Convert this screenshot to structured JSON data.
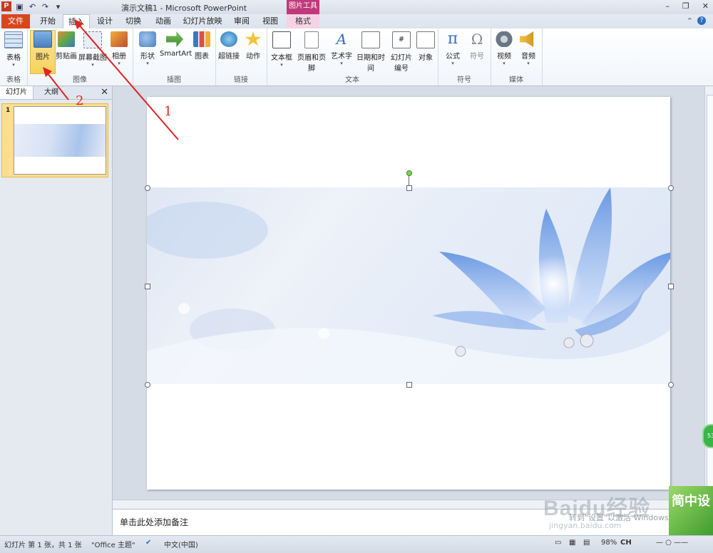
{
  "window": {
    "title": "演示文稿1 - Microsoft PowerPoint",
    "context_tool": "图片工具",
    "app_icon": "P",
    "controls": [
      "–",
      "❐",
      "✕"
    ]
  },
  "tabs": [
    {
      "label": "文件"
    },
    {
      "label": "开始"
    },
    {
      "label": "插入"
    },
    {
      "label": "设计"
    },
    {
      "label": "切换"
    },
    {
      "label": "动画"
    },
    {
      "label": "幻灯片放映"
    },
    {
      "label": "审阅"
    },
    {
      "label": "视图"
    },
    {
      "label": "格式"
    }
  ],
  "ribbon": {
    "groups": [
      {
        "label": "表格",
        "buttons": [
          {
            "label": "表格"
          }
        ]
      },
      {
        "label": "图像",
        "buttons": [
          {
            "label": "图片"
          },
          {
            "label": "剪贴画"
          },
          {
            "label": "屏幕截图"
          },
          {
            "label": "相册"
          }
        ]
      },
      {
        "label": "插图",
        "buttons": [
          {
            "label": "形状"
          },
          {
            "label": "SmartArt"
          },
          {
            "label": "图表"
          }
        ]
      },
      {
        "label": "链接",
        "buttons": [
          {
            "label": "超链接"
          },
          {
            "label": "动作"
          }
        ]
      },
      {
        "label": "文本",
        "buttons": [
          {
            "label": "文本框"
          },
          {
            "label": "页眉和页脚"
          },
          {
            "label": "艺术字"
          },
          {
            "label": "日期和时间"
          },
          {
            "label": "幻灯片编号"
          },
          {
            "label": "对象"
          }
        ]
      },
      {
        "label": "符号",
        "buttons": [
          {
            "label": "公式"
          },
          {
            "label": "符号"
          }
        ]
      },
      {
        "label": "媒体",
        "buttons": [
          {
            "label": "视频"
          },
          {
            "label": "音频"
          }
        ]
      }
    ]
  },
  "left_pane": {
    "tabs": [
      "幻灯片",
      "大纲"
    ],
    "close": "✕",
    "slide_number": "1"
  },
  "notes": {
    "placeholder": "单击此处添加备注"
  },
  "status": {
    "slide_info": "幻灯片 第 1 张，共 1 张",
    "theme": "\"Office 主题\"",
    "language": "中文(中国)",
    "zoom": "98%",
    "ime": "CH"
  },
  "annotations": {
    "one": "1",
    "two": "2"
  },
  "watermark": {
    "brand": "Baidu经验",
    "url": "jingyan.baidu.com",
    "activate": "转到\"设置\"以激活 Windows。",
    "tile": "简中设",
    "badge": "53"
  },
  "colors": {
    "file_tab": "#d9461e",
    "context_tool": "#c0397a",
    "highlight": "#f6d25d",
    "arrow": "#e22222"
  }
}
